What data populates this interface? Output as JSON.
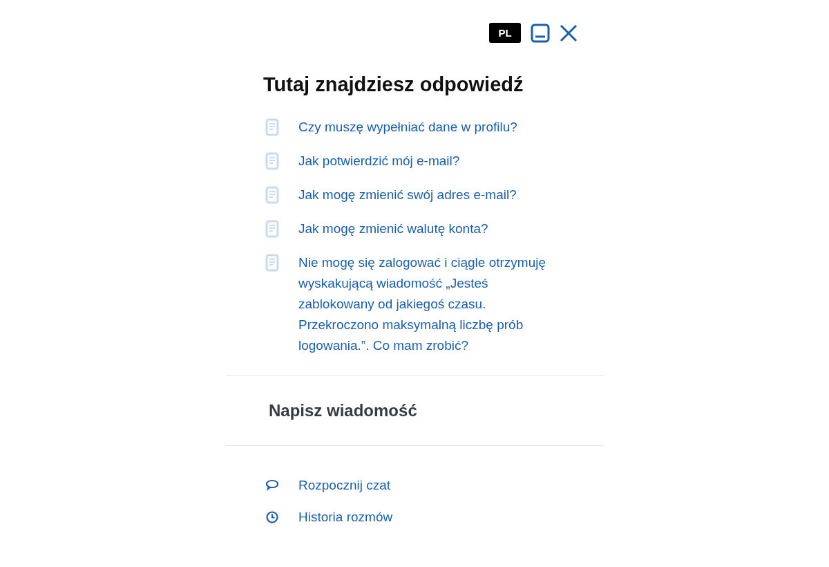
{
  "header": {
    "language": "PL"
  },
  "title": "Tutaj znajdziesz odpowiedź",
  "articles": [
    "Czy muszę wypełniać dane w profilu?",
    "Jak potwierdzić mój e-mail?",
    "Jak mogę zmienić swój adres e-mail?",
    "Jak mogę zmienić walutę konta?",
    "Nie mogę się zalogować i ciągle otrzymuję wyskakującą wiadomość „Jesteś zablokowany od jakiegoś czasu. Przekroczono maksymalną liczbę prób logowania.”. Co mam zrobić?"
  ],
  "message_section": {
    "title": "Napisz wiadomość"
  },
  "actions": [
    {
      "kind": "chat",
      "label": "Rozpocznij czat"
    },
    {
      "kind": "history",
      "label": "Historia rozmów"
    }
  ]
}
